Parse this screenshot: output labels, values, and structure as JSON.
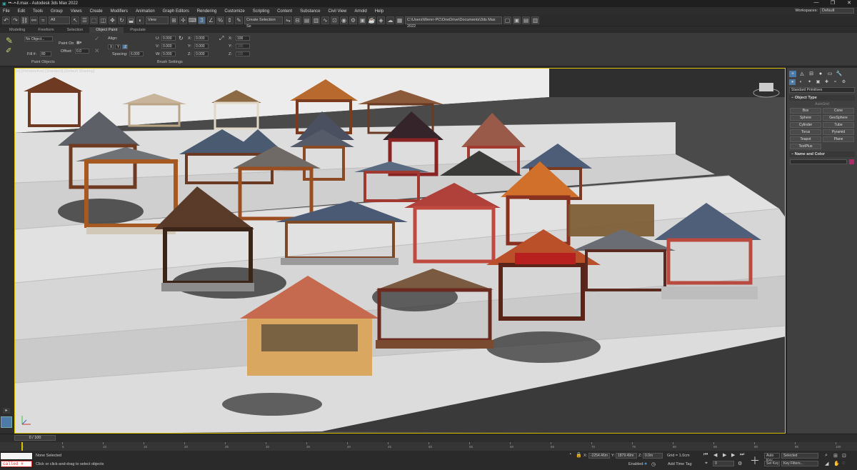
{
  "window": {
    "title": "••--•-ll.max - Autodesk 3ds Max 2022",
    "min": "—",
    "max": "❐",
    "close": "✕"
  },
  "menu": [
    "File",
    "Edit",
    "Tools",
    "Group",
    "Views",
    "Create",
    "Modifiers",
    "Animation",
    "Graph Editors",
    "Rendering",
    "Customize",
    "Scripting",
    "Content",
    "Substance",
    "Civil View",
    "Arnold",
    "Help"
  ],
  "workspaces": {
    "label": "Workspaces:",
    "value": "Default"
  },
  "toolbar": {
    "filter": "All",
    "view": "View",
    "selection_set": "Create Selection Se",
    "path": "C:\\Users\\Wenrr-PC\\OneDrive\\Documents\\3ds Max 2022"
  },
  "ribbon_tabs": [
    "Modeling",
    "Freeform",
    "Selection",
    "Object Paint",
    "Populate"
  ],
  "ribbon_active": "Object Paint",
  "ribbon": {
    "no_object": "No Object...",
    "paint_on": "Paint On",
    "fill": "Fill #:",
    "fill_val": "80",
    "offset": "Offset:",
    "offset_val": "0.0",
    "align": "Align:",
    "axes": [
      "X",
      "Y",
      "Z"
    ],
    "spacing": "Spacing:",
    "spacing_val": "6.000",
    "coords_a": [
      "0.000",
      "0.000",
      "0.000"
    ],
    "coords_b": [
      "0.000",
      "0.000",
      "0.000"
    ],
    "pct": "100",
    "labels_u": [
      "U:",
      "V:",
      "W:"
    ],
    "labels_x": [
      "X:",
      "Y:",
      "Z:"
    ],
    "labels_p": [
      "X:",
      "Y:",
      "Z:"
    ],
    "group1": "Paint Objects",
    "group2": "Brush Settings"
  },
  "viewport": {
    "label": "[+] [Perspective] [Standard] [Default Shading]"
  },
  "command_panel": {
    "category": "Standard Primitives",
    "rollout1": "Object Type",
    "autogrid": "AutoGrid",
    "buttons": [
      "Box",
      "Cone",
      "Sphere",
      "GeoSphere",
      "Cylinder",
      "Tube",
      "Torus",
      "Pyramid",
      "Teapot",
      "Plane",
      "TextPlus"
    ],
    "rollout2": "Name and Color",
    "accent": "#b02a6a"
  },
  "timeline": {
    "slider": "0 / 100",
    "ticks": [
      "0",
      "5",
      "10",
      "15",
      "20",
      "25",
      "30",
      "35",
      "40",
      "45",
      "50",
      "55",
      "60",
      "65",
      "70",
      "75",
      "80",
      "85",
      "90",
      "95",
      "100"
    ]
  },
  "status": {
    "maxscript_top": "called #",
    "maxscript_bottom": "called #",
    "none_selected": "None Selected",
    "prompt": "Click or click-and-drag to select objects",
    "x_label": "X:",
    "x_val": "-2254.46m",
    "y_label": "Y:",
    "y_val": "1879.49m",
    "z_label": "Z:",
    "z_val": "0.0m",
    "grid": "Grid = 1.0cm",
    "enabled": "Enabled:",
    "add_time_tag": "Add Time Tag",
    "autokey": "Auto Key",
    "setkey": "Set Key",
    "selected": "Selected",
    "key_filters": "Key Filters...",
    "frame": "0"
  }
}
